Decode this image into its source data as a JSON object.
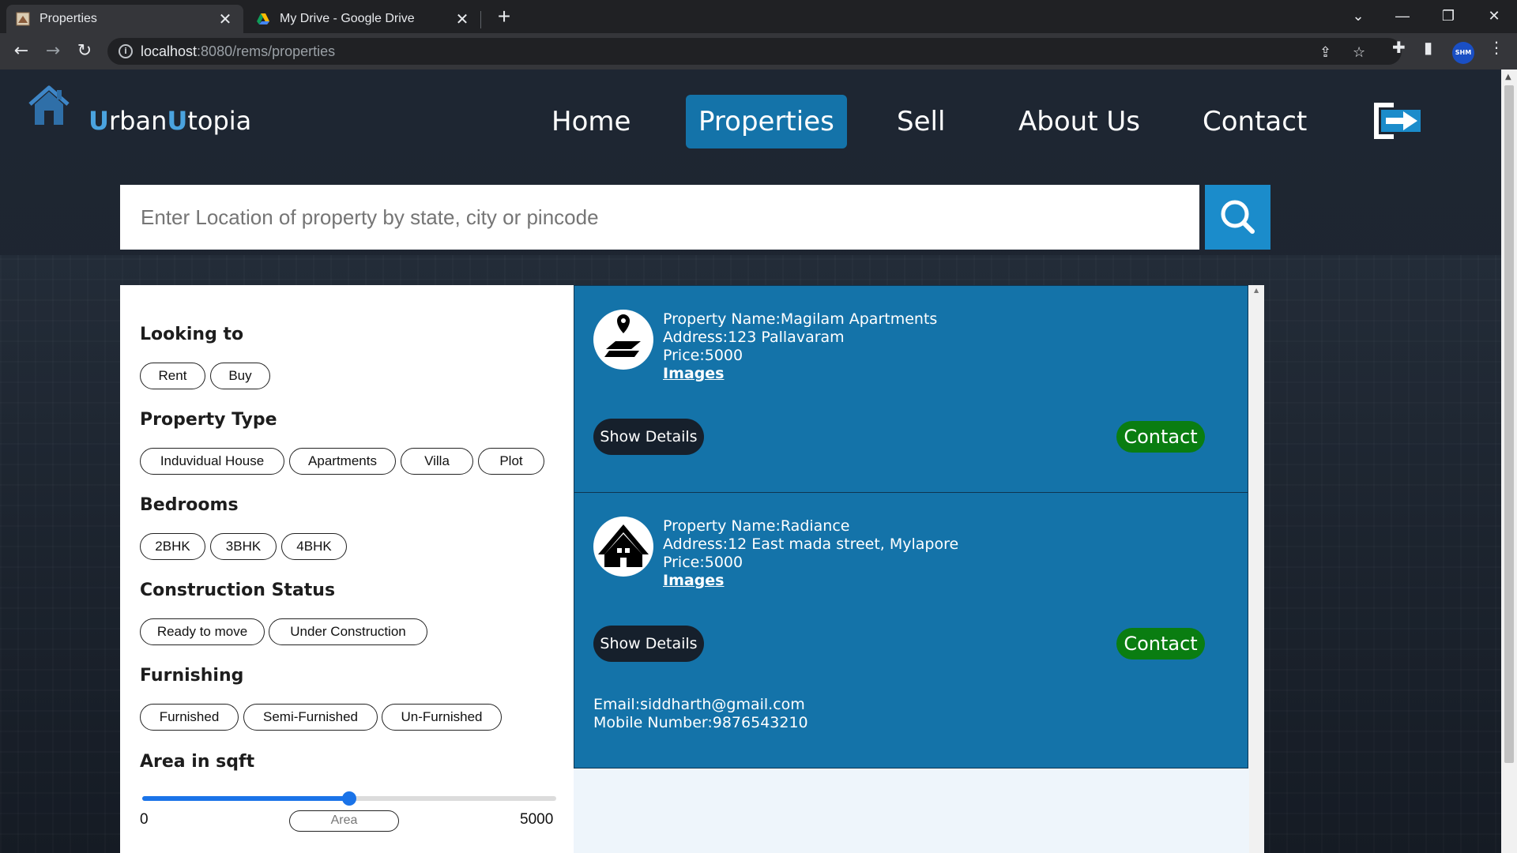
{
  "browser": {
    "tabs": [
      {
        "title": "Properties",
        "active": true,
        "icon": "page-favicon"
      },
      {
        "title": "My Drive - Google Drive",
        "active": false,
        "icon": "google-drive-icon"
      }
    ],
    "url_host": "localhost",
    "url_path": ":8080/rems/properties",
    "profile_initials": "SHM"
  },
  "header": {
    "brand_u1": "U",
    "brand_part1": "rban",
    "brand_u2": "U",
    "brand_part2": "topia",
    "nav": [
      "Home",
      "Properties",
      "Sell",
      "About Us",
      "Contact"
    ],
    "active_nav": "Properties"
  },
  "search": {
    "placeholder": "Enter Location of property by state, city or pincode"
  },
  "filters": {
    "looking_to": {
      "title": "Looking to",
      "options": [
        "Rent",
        "Buy"
      ]
    },
    "property_type": {
      "title": "Property Type",
      "options": [
        "Induvidual House",
        "Apartments",
        "Villa",
        "Plot"
      ]
    },
    "bedrooms": {
      "title": "Bedrooms",
      "options": [
        "2BHK",
        "3BHK",
        "4BHK"
      ]
    },
    "construction_status": {
      "title": "Construction Status",
      "options": [
        "Ready to move",
        "Under Construction"
      ]
    },
    "furnishing": {
      "title": "Furnishing",
      "options": [
        "Furnished",
        "Semi-Furnished",
        "Un-Furnished"
      ]
    },
    "area": {
      "title": "Area in sqft",
      "min_label": "0",
      "max_label": "5000",
      "placeholder": "Area",
      "slider_fraction": 0.5
    }
  },
  "properties": [
    {
      "name": "Property Name:Magilam Apartments",
      "address": "Address:123 Pallavaram",
      "price": "Price:5000",
      "images_link": "Images",
      "show_details_label": "Show Details",
      "contact_label": "Contact",
      "icon": "location-map-icon"
    },
    {
      "name": "Property Name:Radiance",
      "address": "Address:12 East mada street, Mylapore",
      "price": "Price:5000",
      "images_link": "Images",
      "show_details_label": "Show Details",
      "contact_label": "Contact",
      "email": "Email:siddharth@gmail.com",
      "mobile": "Mobile Number:9876543210",
      "icon": "house-icon"
    }
  ],
  "colors": {
    "accent": "#1473a9",
    "search_button": "#1b8ccb",
    "contact_green": "#0a7d11",
    "page_bg": "#1e2530"
  }
}
